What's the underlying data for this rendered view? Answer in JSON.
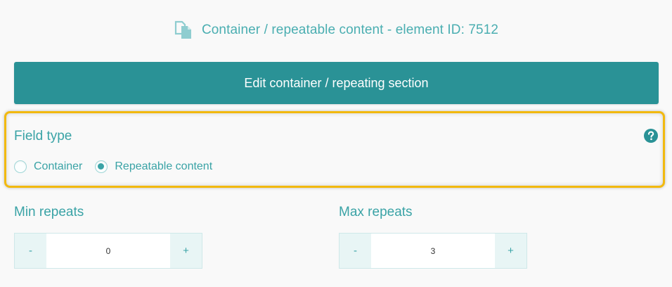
{
  "header": {
    "icon": "copy-document-icon",
    "title": "Container / repeatable content - element ID: 7512"
  },
  "edit_button": {
    "label": "Edit container / repeating section"
  },
  "field_type": {
    "label": "Field type",
    "help_icon": "question-circle-icon",
    "options": [
      {
        "label": "Container",
        "checked": false
      },
      {
        "label": "Repeatable content",
        "checked": true
      }
    ]
  },
  "min_repeats": {
    "label": "Min repeats",
    "decrement": "-",
    "value": "0",
    "increment": "+"
  },
  "max_repeats": {
    "label": "Max repeats",
    "decrement": "-",
    "value": "3",
    "increment": "+"
  },
  "colors": {
    "accent": "#2a9296",
    "text_teal": "#3aa3a6",
    "highlight_border": "#f2b90f",
    "background": "#f9f9f9"
  }
}
